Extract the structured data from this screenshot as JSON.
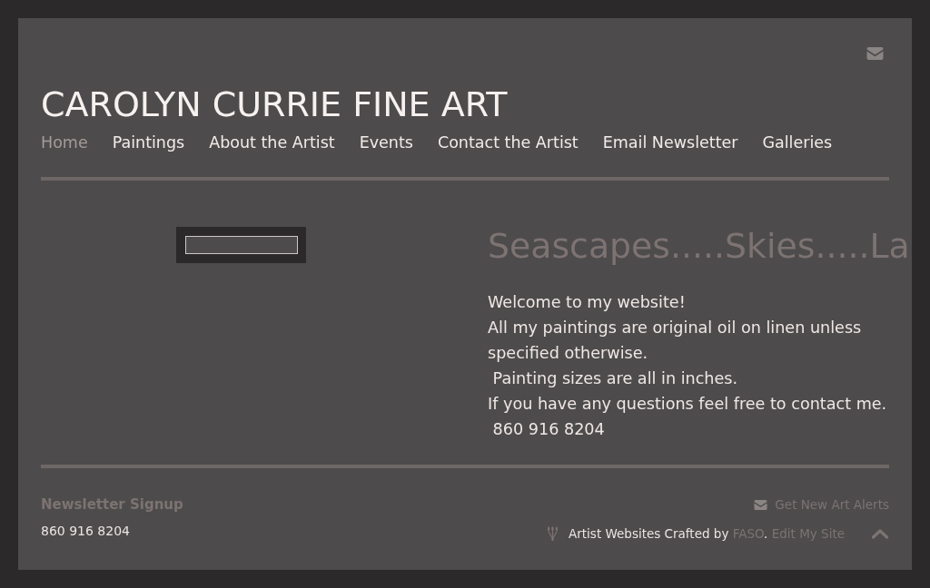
{
  "header": {
    "title": "CAROLYN CURRIE FINE ART"
  },
  "nav": [
    {
      "label": "Home",
      "selected": true
    },
    {
      "label": "Paintings",
      "selected": false
    },
    {
      "label": "About the Artist",
      "selected": false
    },
    {
      "label": "Events",
      "selected": false
    },
    {
      "label": "Contact the Artist",
      "selected": false
    },
    {
      "label": "Email Newsletter",
      "selected": false
    },
    {
      "label": "Galleries",
      "selected": false
    }
  ],
  "main": {
    "heading": "Seascapes.....Skies.....La",
    "welcome_lines": [
      "Welcome to my website!",
      "All my paintings are original oil on linen unless specified otherwise.",
      " Painting sizes are all in inches.",
      "If you have any questions feel free to contact me.",
      " 860 916 8204"
    ]
  },
  "footer": {
    "newsletter_heading": "Newsletter Signup",
    "phone": "860 916 8204",
    "alerts_link": "Get New Art Alerts",
    "credit": [
      {
        "kind": "text",
        "text": "Artist Websites Crafted by "
      },
      {
        "kind": "link",
        "text": "FASO"
      },
      {
        "kind": "text",
        "text": ". "
      },
      {
        "kind": "link",
        "text": "Edit My Site"
      }
    ]
  }
}
